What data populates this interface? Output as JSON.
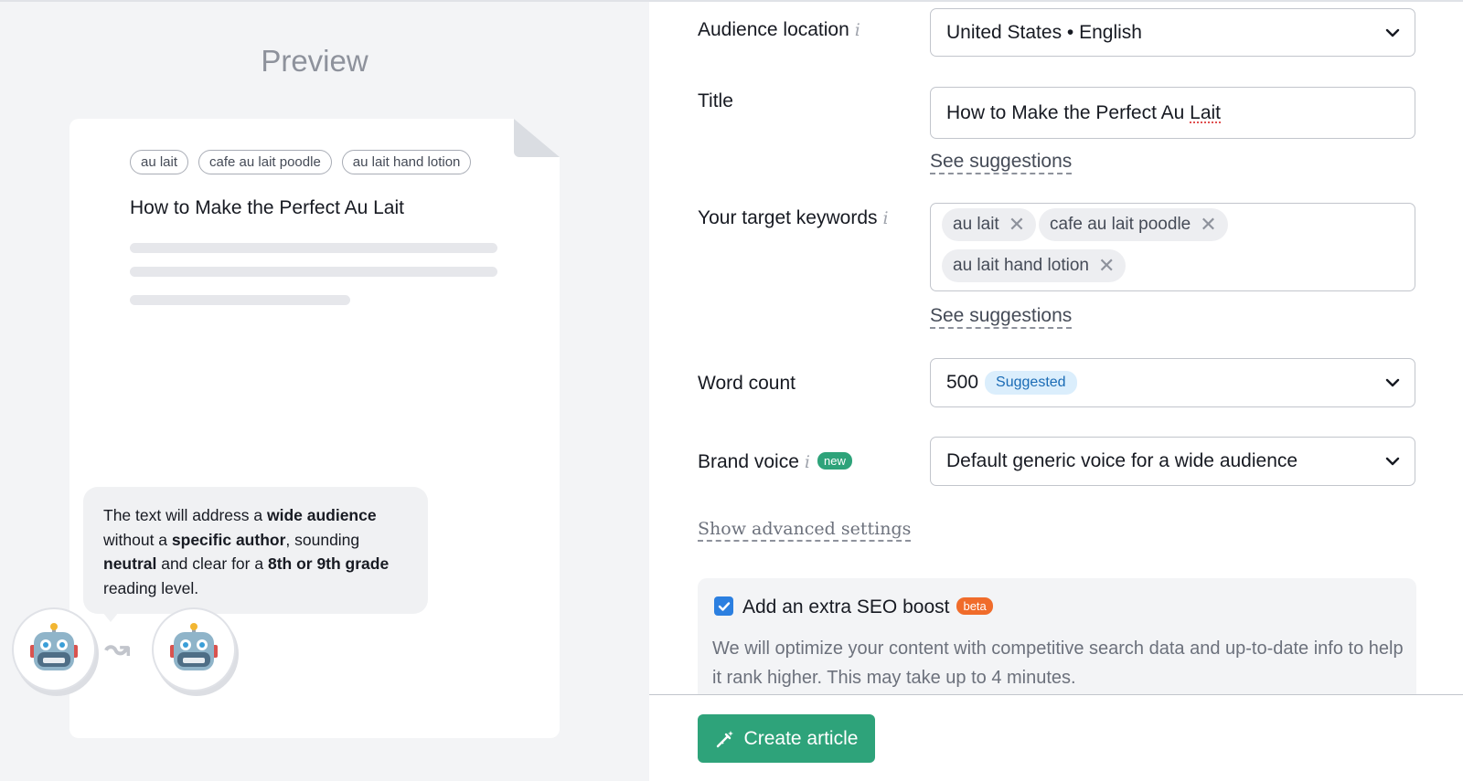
{
  "preview": {
    "title": "Preview",
    "tags": [
      "au lait",
      "cafe au lait poodle",
      "au lait hand lotion"
    ],
    "article_title": "How to Make the Perfect Au Lait",
    "bubble": {
      "p1": "The text will address a ",
      "b1": "wide audience",
      "p2": " without a ",
      "b2": "specific author",
      "p3": ", sounding ",
      "b3": "neutral",
      "p4": " and clear for a ",
      "b4": "8th or 9th grade",
      "p5": " reading level."
    }
  },
  "form": {
    "audience_location": {
      "label": "Audience location",
      "value": "United States • English"
    },
    "title": {
      "label": "Title",
      "value_a": "How to Make the Perfect Au ",
      "value_b": "Lait"
    },
    "see_suggestions": "See suggestions",
    "keywords": {
      "label": "Your target keywords",
      "chips": [
        "au lait",
        "cafe au lait poodle",
        "au lait hand lotion"
      ]
    },
    "word_count": {
      "label": "Word count",
      "value": "500",
      "badge": "Suggested"
    },
    "brand_voice": {
      "label": "Brand voice",
      "badge": "new",
      "value": "Default generic voice for a wide audience"
    },
    "advanced": "Show advanced settings",
    "seo": {
      "checked": true,
      "label": "Add an extra SEO boost",
      "badge": "beta",
      "description": "We will optimize your content with competitive search data and up-to-date info to help it rank higher. This may take up to 4 minutes."
    },
    "create_button": "Create article"
  },
  "icons": {
    "info": "i",
    "chip_remove": "✕",
    "arrow": "↝"
  },
  "colors": {
    "accent_green": "#2ea37a",
    "checkbox_blue": "#2b7fe0",
    "beta_orange": "#f06c2b",
    "suggested_bg": "#dbeefc",
    "suggested_text": "#1a6bb5"
  }
}
